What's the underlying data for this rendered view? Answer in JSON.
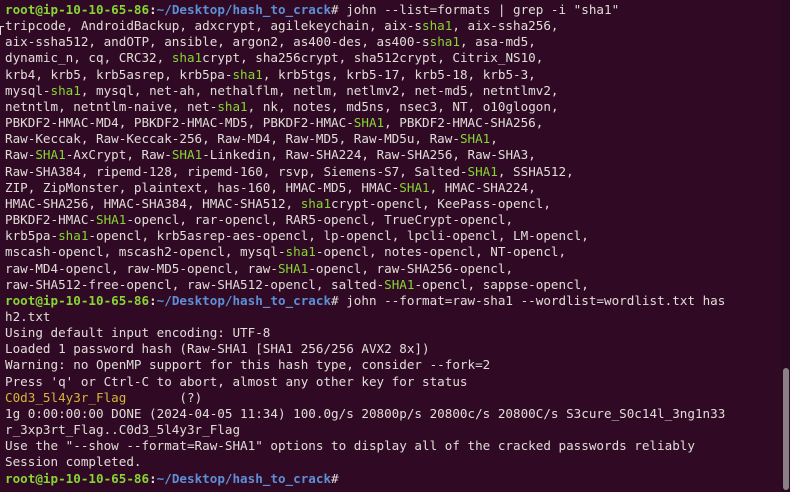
{
  "colors": {
    "background": "#300a24",
    "text": "#e0dcd8",
    "prompt_user": "#87d633",
    "prompt_path": "#5d8fd6",
    "grep_match": "#87d633",
    "cracked_flag": "#d6b53a"
  },
  "terminal": {
    "lines": [
      [
        {
          "t": "root@ip-10-10-65-86",
          "c": "prompt-user"
        },
        {
          "t": ":",
          "c": "prompt-sep"
        },
        {
          "t": "~/Desktop/hash_to_crack",
          "c": "prompt-path"
        },
        {
          "t": "# john --list=formats | grep -i \"sha1\""
        }
      ],
      [
        {
          "t": "tripcode, AndroidBackup, adxcrypt, agilekeychain, aix-s"
        },
        {
          "t": "sha1",
          "c": "match"
        },
        {
          "t": ", aix-ssha256,"
        }
      ],
      [
        {
          "t": "aix-ssha512, andOTP, ansible, argon2, as400-des, as400-s"
        },
        {
          "t": "sha1",
          "c": "match"
        },
        {
          "t": ", asa-md5,"
        }
      ],
      [
        {
          "t": "dynamic_n, cq, CRC32, "
        },
        {
          "t": "sha1",
          "c": "match"
        },
        {
          "t": "crypt, sha256crypt, sha512crypt, Citrix_NS10,"
        }
      ],
      [
        {
          "t": "krb4, krb5, krb5asrep, krb5pa-"
        },
        {
          "t": "sha1",
          "c": "match"
        },
        {
          "t": ", krb5tgs, krb5-17, krb5-18, krb5-3,"
        }
      ],
      [
        {
          "t": "mysql-"
        },
        {
          "t": "sha1",
          "c": "match"
        },
        {
          "t": ", mysql, net-ah, nethalflm, netlm, netlmv2, net-md5, netntlmv2,"
        }
      ],
      [
        {
          "t": "netntlm, netntlm-naive, net-"
        },
        {
          "t": "sha1",
          "c": "match"
        },
        {
          "t": ", nk, notes, md5ns, nsec3, NT, o10glogon,"
        }
      ],
      [
        {
          "t": "PBKDF2-HMAC-MD4, PBKDF2-HMAC-MD5, PBKDF2-HMAC-"
        },
        {
          "t": "SHA1",
          "c": "match"
        },
        {
          "t": ", PBKDF2-HMAC-SHA256,"
        }
      ],
      [
        {
          "t": "Raw-Keccak, Raw-Keccak-256, Raw-MD4, Raw-MD5, Raw-MD5u, Raw-"
        },
        {
          "t": "SHA1",
          "c": "match"
        },
        {
          "t": ","
        }
      ],
      [
        {
          "t": "Raw-"
        },
        {
          "t": "SHA1",
          "c": "match"
        },
        {
          "t": "-AxCrypt, Raw-"
        },
        {
          "t": "SHA1",
          "c": "match"
        },
        {
          "t": "-Linkedin, Raw-SHA224, Raw-SHA256, Raw-SHA3,"
        }
      ],
      [
        {
          "t": "Raw-SHA384, ripemd-128, ripemd-160, rsvp, Siemens-S7, Salted-"
        },
        {
          "t": "SHA1",
          "c": "match"
        },
        {
          "t": ", SSHA512,"
        }
      ],
      [
        {
          "t": "ZIP, ZipMonster, plaintext, has-160, HMAC-MD5, HMAC-"
        },
        {
          "t": "SHA1",
          "c": "match"
        },
        {
          "t": ", HMAC-SHA224,"
        }
      ],
      [
        {
          "t": "HMAC-SHA256, HMAC-SHA384, HMAC-SHA512, "
        },
        {
          "t": "sha1",
          "c": "match"
        },
        {
          "t": "crypt-opencl, KeePass-opencl,"
        }
      ],
      [
        {
          "t": "PBKDF2-HMAC-"
        },
        {
          "t": "SHA1",
          "c": "match"
        },
        {
          "t": "-opencl, rar-opencl, RAR5-opencl, TrueCrypt-opencl,"
        }
      ],
      [
        {
          "t": "krb5pa-"
        },
        {
          "t": "sha1",
          "c": "match"
        },
        {
          "t": "-opencl, krb5asrep-aes-opencl, lp-opencl, lpcli-opencl, LM-opencl,"
        }
      ],
      [
        {
          "t": "mscash-opencl, mscash2-opencl, mysql-"
        },
        {
          "t": "sha1",
          "c": "match"
        },
        {
          "t": "-opencl, notes-opencl, NT-opencl,"
        }
      ],
      [
        {
          "t": "raw-MD4-opencl, raw-MD5-opencl, raw-"
        },
        {
          "t": "SHA1",
          "c": "match"
        },
        {
          "t": "-opencl, raw-SHA256-opencl,"
        }
      ],
      [
        {
          "t": "raw-SHA512-free-opencl, raw-SHA512-opencl, salted-"
        },
        {
          "t": "SHA1",
          "c": "match"
        },
        {
          "t": "-opencl, sappse-opencl,"
        }
      ],
      [
        {
          "t": "root@ip-10-10-65-86",
          "c": "prompt-user"
        },
        {
          "t": ":",
          "c": "prompt-sep"
        },
        {
          "t": "~/Desktop/hash_to_crack",
          "c": "prompt-path"
        },
        {
          "t": "# john --format=raw-sha1 --wordlist=wordlist.txt has"
        }
      ],
      [
        {
          "t": "h2.txt"
        }
      ],
      [
        {
          "t": "Using default input encoding: UTF-8"
        }
      ],
      [
        {
          "t": "Loaded 1 password hash (Raw-SHA1 [SHA1 256/256 AVX2 8x])"
        }
      ],
      [
        {
          "t": "Warning: no OpenMP support for this hash type, consider --fork=2"
        }
      ],
      [
        {
          "t": "Press 'q' or Ctrl-C to abort, almost any other key for status"
        }
      ],
      [
        {
          "t": "C0d3_5l4y3r_Flag",
          "c": "flag"
        },
        {
          "t": "       "
        },
        {
          "t": "(?)"
        }
      ],
      [
        {
          "t": "1g 0:00:00:00 DONE (2024-04-05 11:34) 100.0g/s 20800p/s 20800c/s 20800C/s S3cure_S0c14l_3ng1n33"
        }
      ],
      [
        {
          "t": "r_3xp3rt_Flag..C0d3_5l4y3r_Flag"
        }
      ],
      [
        {
          "t": "Use the \"--show --format=Raw-SHA1\" options to display all of the cracked passwords reliably"
        }
      ],
      [
        {
          "t": "Session completed."
        }
      ],
      [
        {
          "t": "root@ip-10-10-65-86",
          "c": "prompt-user"
        },
        {
          "t": ":",
          "c": "prompt-sep"
        },
        {
          "t": "~/Desktop/hash_to_crack",
          "c": "prompt-path"
        },
        {
          "t": "# "
        }
      ]
    ]
  }
}
